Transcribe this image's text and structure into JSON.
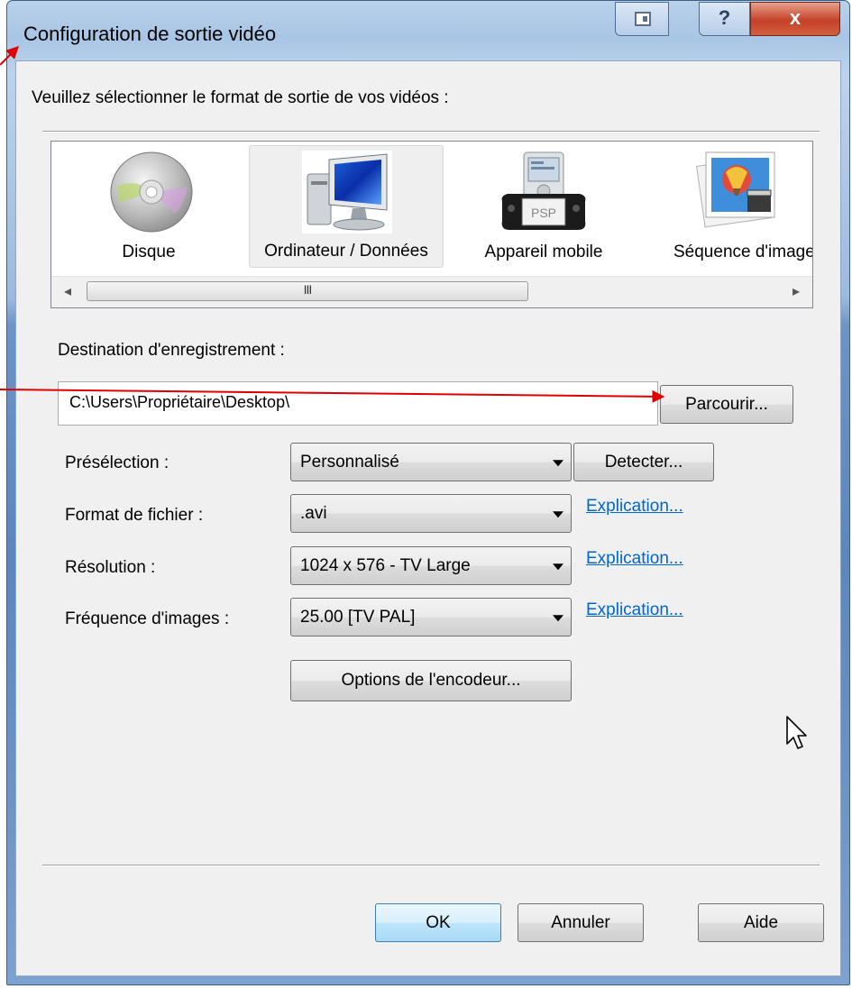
{
  "window": {
    "title": "Configuration de sortie vidéo",
    "controls": {
      "help": "?",
      "close": "x"
    }
  },
  "instruction": "Veuillez sélectionner le format de sortie de vos vidéos :",
  "gallery": {
    "items": [
      {
        "label": "Disque",
        "icon": "disc-icon"
      },
      {
        "label": "Ordinateur / Données",
        "icon": "computer-icon",
        "selected": true
      },
      {
        "label": "Appareil mobile",
        "icon": "psp-device-icon",
        "screen_text": "PSP"
      },
      {
        "label": "Séquence d'image",
        "icon": "image-sequence-icon"
      }
    ],
    "scrollbar_grip": "III"
  },
  "destination": {
    "label": "Destination d'enregistrement :",
    "path": "C:\\Users\\Propriétaire\\Desktop\\",
    "browse_label": "Parcourir..."
  },
  "fields": {
    "preset": {
      "label": "Présélection :",
      "value": "Personnalisé",
      "detect_label": "Detecter..."
    },
    "format": {
      "label": "Format de fichier :",
      "value": ".avi",
      "link": "Explication..."
    },
    "resolution": {
      "label": "Résolution :",
      "value": "1024 x 576 - TV Large",
      "link": "Explication..."
    },
    "framerate": {
      "label": "Fréquence d'images :",
      "value": "25.00 [TV PAL]",
      "link": "Explication..."
    }
  },
  "encoder_button": "Options de l'encodeur...",
  "footer": {
    "ok": "OK",
    "cancel": "Annuler",
    "help": "Aide"
  },
  "colors": {
    "link": "#0066cc",
    "annotation_arrow": "#e00000",
    "title_bar": "#a9c5e5"
  }
}
